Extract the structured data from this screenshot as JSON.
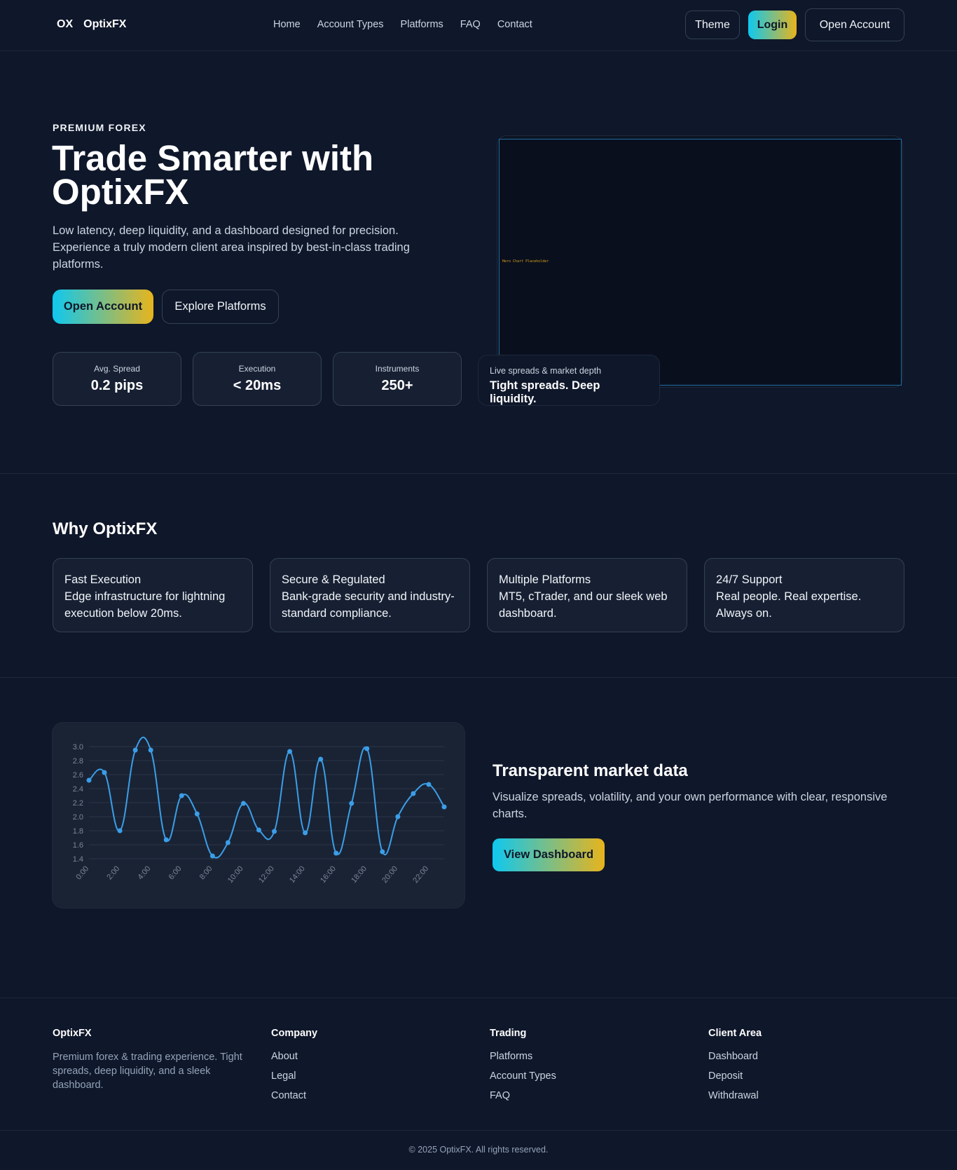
{
  "header": {
    "logo_mark": "OX",
    "brand": "OptixFX",
    "nav": [
      "Home",
      "Account Types",
      "Platforms",
      "FAQ",
      "Contact"
    ],
    "theme_label": "Theme",
    "login_label": "Login",
    "open_account_label": "Open Account"
  },
  "hero": {
    "eyebrow": "PREMIUM FOREX",
    "title": "Trade Smarter with OptixFX",
    "subtitle": "Low latency, deep liquidity, and a dashboard designed for precision. Experience a truly modern client area inspired by best-in-class trading platforms.",
    "primary_cta": "Open Account",
    "secondary_cta": "Explore Platforms",
    "chart_placeholder": "Hero Chart Placeholder",
    "stats": [
      {
        "label": "Avg. Spread",
        "value": "0.2 pips"
      },
      {
        "label": "Execution",
        "value": "< 20ms"
      },
      {
        "label": "Instruments",
        "value": "250+"
      }
    ],
    "badge": {
      "small": "Live spreads & market depth",
      "big": "Tight spreads. Deep liquidity."
    }
  },
  "why": {
    "title": "Why OptixFX",
    "features": [
      {
        "title": "Fast Execution",
        "desc": "Edge infrastructure for lightning execution below 20ms."
      },
      {
        "title": "Secure & Regulated",
        "desc": "Bank-grade security and industry-standard compliance."
      },
      {
        "title": "Multiple Platforms",
        "desc": "MT5, cTrader, and our sleek web dashboard."
      },
      {
        "title": "24/7 Support",
        "desc": "Real people. Real expertise. Always on."
      }
    ]
  },
  "market": {
    "title": "Transparent market data",
    "subtitle": "Visualize spreads, volatility, and your own performance with clear, responsive charts.",
    "cta": "View Dashboard"
  },
  "chart_data": {
    "type": "line",
    "x": [
      "0:00",
      "1:00",
      "2:00",
      "3:00",
      "4:00",
      "5:00",
      "6:00",
      "7:00",
      "8:00",
      "9:00",
      "10:00",
      "11:00",
      "12:00",
      "13:00",
      "14:00",
      "15:00",
      "16:00",
      "17:00",
      "18:00",
      "19:00",
      "20:00",
      "21:00",
      "22:00",
      "23:00"
    ],
    "x_tick_labels": [
      "0:00",
      "2:00",
      "4:00",
      "6:00",
      "8:00",
      "10:00",
      "12:00",
      "14:00",
      "16:00",
      "18:00",
      "20:00",
      "22:00"
    ],
    "values": [
      2.52,
      2.63,
      1.8,
      2.95,
      2.95,
      1.67,
      2.3,
      2.04,
      1.44,
      1.63,
      2.19,
      1.81,
      1.79,
      2.93,
      1.77,
      2.82,
      1.48,
      2.19,
      2.97,
      1.5,
      2.0,
      2.33,
      2.46,
      2.14
    ],
    "y_ticks": [
      "1.4",
      "1.6",
      "1.8",
      "2.0",
      "2.2",
      "2.4",
      "2.6",
      "2.8",
      "3.0"
    ],
    "ylim": [
      1.4,
      3.0
    ],
    "grid": true,
    "color": "#3b9ee8"
  },
  "footer": {
    "brand": {
      "title": "OptixFX",
      "desc": "Premium forex & trading experience. Tight spreads, deep liquidity, and a sleek dashboard."
    },
    "company": {
      "title": "Company",
      "links": [
        "About",
        "Legal",
        "Contact"
      ]
    },
    "trading": {
      "title": "Trading",
      "links": [
        "Platforms",
        "Account Types",
        "FAQ"
      ]
    },
    "client": {
      "title": "Client Area",
      "links": [
        "Dashboard",
        "Deposit",
        "Withdrawal"
      ]
    },
    "copyright": "© 2025 OptixFX. All rights reserved."
  }
}
